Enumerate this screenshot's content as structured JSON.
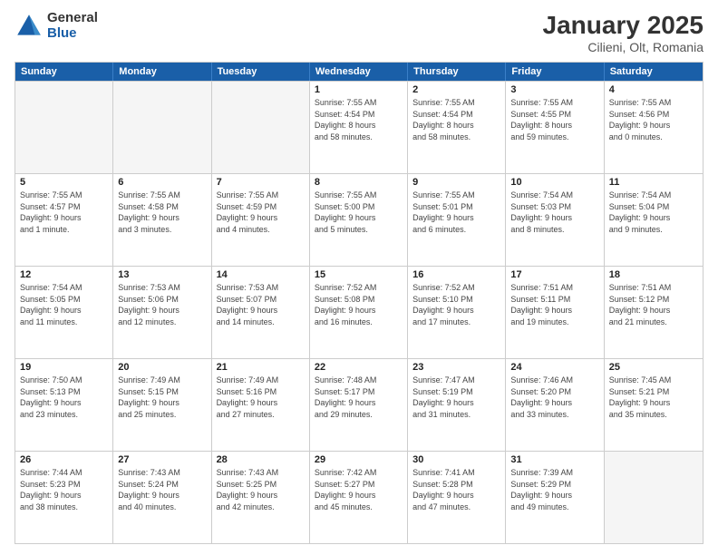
{
  "header": {
    "logo_general": "General",
    "logo_blue": "Blue",
    "month": "January 2025",
    "location": "Cilieni, Olt, Romania"
  },
  "weekdays": [
    "Sunday",
    "Monday",
    "Tuesday",
    "Wednesday",
    "Thursday",
    "Friday",
    "Saturday"
  ],
  "weeks": [
    [
      {
        "day": "",
        "info": ""
      },
      {
        "day": "",
        "info": ""
      },
      {
        "day": "",
        "info": ""
      },
      {
        "day": "1",
        "info": "Sunrise: 7:55 AM\nSunset: 4:54 PM\nDaylight: 8 hours\nand 58 minutes."
      },
      {
        "day": "2",
        "info": "Sunrise: 7:55 AM\nSunset: 4:54 PM\nDaylight: 8 hours\nand 58 minutes."
      },
      {
        "day": "3",
        "info": "Sunrise: 7:55 AM\nSunset: 4:55 PM\nDaylight: 8 hours\nand 59 minutes."
      },
      {
        "day": "4",
        "info": "Sunrise: 7:55 AM\nSunset: 4:56 PM\nDaylight: 9 hours\nand 0 minutes."
      }
    ],
    [
      {
        "day": "5",
        "info": "Sunrise: 7:55 AM\nSunset: 4:57 PM\nDaylight: 9 hours\nand 1 minute."
      },
      {
        "day": "6",
        "info": "Sunrise: 7:55 AM\nSunset: 4:58 PM\nDaylight: 9 hours\nand 3 minutes."
      },
      {
        "day": "7",
        "info": "Sunrise: 7:55 AM\nSunset: 4:59 PM\nDaylight: 9 hours\nand 4 minutes."
      },
      {
        "day": "8",
        "info": "Sunrise: 7:55 AM\nSunset: 5:00 PM\nDaylight: 9 hours\nand 5 minutes."
      },
      {
        "day": "9",
        "info": "Sunrise: 7:55 AM\nSunset: 5:01 PM\nDaylight: 9 hours\nand 6 minutes."
      },
      {
        "day": "10",
        "info": "Sunrise: 7:54 AM\nSunset: 5:03 PM\nDaylight: 9 hours\nand 8 minutes."
      },
      {
        "day": "11",
        "info": "Sunrise: 7:54 AM\nSunset: 5:04 PM\nDaylight: 9 hours\nand 9 minutes."
      }
    ],
    [
      {
        "day": "12",
        "info": "Sunrise: 7:54 AM\nSunset: 5:05 PM\nDaylight: 9 hours\nand 11 minutes."
      },
      {
        "day": "13",
        "info": "Sunrise: 7:53 AM\nSunset: 5:06 PM\nDaylight: 9 hours\nand 12 minutes."
      },
      {
        "day": "14",
        "info": "Sunrise: 7:53 AM\nSunset: 5:07 PM\nDaylight: 9 hours\nand 14 minutes."
      },
      {
        "day": "15",
        "info": "Sunrise: 7:52 AM\nSunset: 5:08 PM\nDaylight: 9 hours\nand 16 minutes."
      },
      {
        "day": "16",
        "info": "Sunrise: 7:52 AM\nSunset: 5:10 PM\nDaylight: 9 hours\nand 17 minutes."
      },
      {
        "day": "17",
        "info": "Sunrise: 7:51 AM\nSunset: 5:11 PM\nDaylight: 9 hours\nand 19 minutes."
      },
      {
        "day": "18",
        "info": "Sunrise: 7:51 AM\nSunset: 5:12 PM\nDaylight: 9 hours\nand 21 minutes."
      }
    ],
    [
      {
        "day": "19",
        "info": "Sunrise: 7:50 AM\nSunset: 5:13 PM\nDaylight: 9 hours\nand 23 minutes."
      },
      {
        "day": "20",
        "info": "Sunrise: 7:49 AM\nSunset: 5:15 PM\nDaylight: 9 hours\nand 25 minutes."
      },
      {
        "day": "21",
        "info": "Sunrise: 7:49 AM\nSunset: 5:16 PM\nDaylight: 9 hours\nand 27 minutes."
      },
      {
        "day": "22",
        "info": "Sunrise: 7:48 AM\nSunset: 5:17 PM\nDaylight: 9 hours\nand 29 minutes."
      },
      {
        "day": "23",
        "info": "Sunrise: 7:47 AM\nSunset: 5:19 PM\nDaylight: 9 hours\nand 31 minutes."
      },
      {
        "day": "24",
        "info": "Sunrise: 7:46 AM\nSunset: 5:20 PM\nDaylight: 9 hours\nand 33 minutes."
      },
      {
        "day": "25",
        "info": "Sunrise: 7:45 AM\nSunset: 5:21 PM\nDaylight: 9 hours\nand 35 minutes."
      }
    ],
    [
      {
        "day": "26",
        "info": "Sunrise: 7:44 AM\nSunset: 5:23 PM\nDaylight: 9 hours\nand 38 minutes."
      },
      {
        "day": "27",
        "info": "Sunrise: 7:43 AM\nSunset: 5:24 PM\nDaylight: 9 hours\nand 40 minutes."
      },
      {
        "day": "28",
        "info": "Sunrise: 7:43 AM\nSunset: 5:25 PM\nDaylight: 9 hours\nand 42 minutes."
      },
      {
        "day": "29",
        "info": "Sunrise: 7:42 AM\nSunset: 5:27 PM\nDaylight: 9 hours\nand 45 minutes."
      },
      {
        "day": "30",
        "info": "Sunrise: 7:41 AM\nSunset: 5:28 PM\nDaylight: 9 hours\nand 47 minutes."
      },
      {
        "day": "31",
        "info": "Sunrise: 7:39 AM\nSunset: 5:29 PM\nDaylight: 9 hours\nand 49 minutes."
      },
      {
        "day": "",
        "info": ""
      }
    ]
  ]
}
